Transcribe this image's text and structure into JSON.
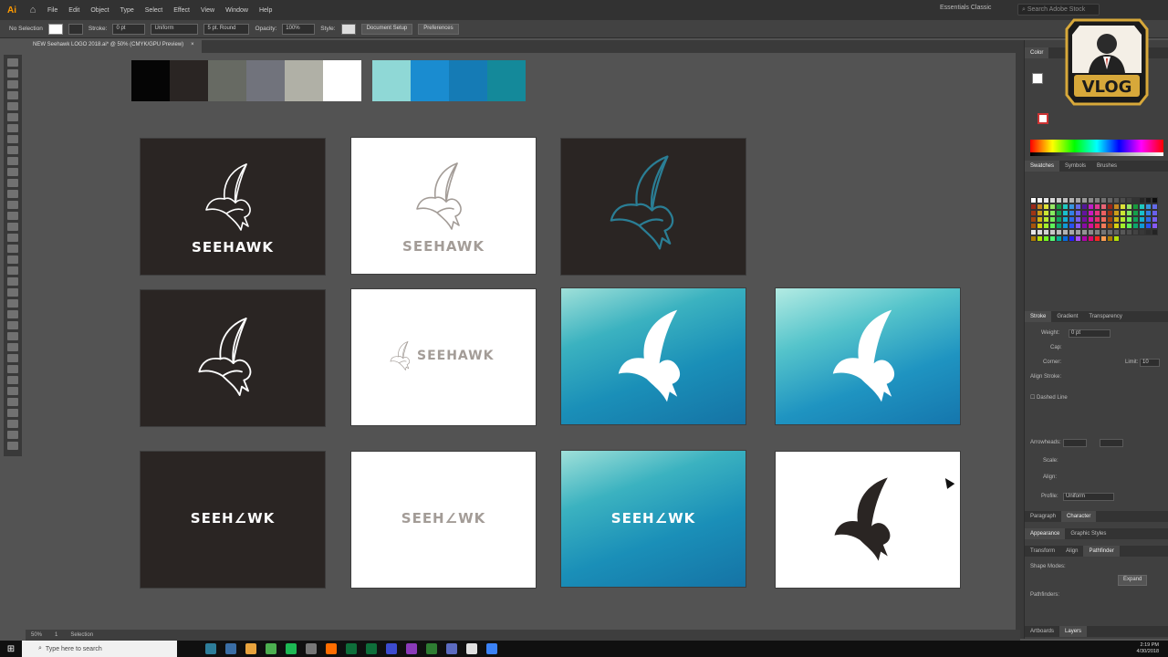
{
  "menubar": {
    "app_icon": "Ai",
    "items": [
      "File",
      "Edit",
      "Object",
      "Type",
      "Select",
      "Effect",
      "View",
      "Window",
      "Help"
    ],
    "workspace": "Essentials Classic",
    "search_placeholder": "Search Adobe Stock"
  },
  "controlbar": {
    "selection": "No Selection",
    "stroke_label": "Stroke:",
    "stroke_value": "0 pt",
    "profile": "Uniform",
    "brush": "5 pt. Round",
    "opacity_label": "Opacity:",
    "opacity_value": "100%",
    "style_label": "Style:",
    "doc_setup": "Document Setup",
    "preferences": "Preferences"
  },
  "document_tab": {
    "title": "NEW Seehawk LOGO 2018.ai* @ 50% (CMYK/GPU Preview)",
    "close": "×"
  },
  "palette": {
    "neutrals": [
      "#050505",
      "#2a2523",
      "#676a63",
      "#71737c",
      "#b0b0a6",
      "#ffffff"
    ],
    "blues": [
      "#8fd8d6",
      "#1a8cd0",
      "#157bb5",
      "#14899a"
    ]
  },
  "logo": {
    "wordmark": "SEEHAWK",
    "wordmark_alt": "SEEH∠WK",
    "stroke_grey": "#a39c97",
    "stroke_teal": "#2a7e95"
  },
  "right_panel": {
    "color_tab": "Color",
    "swatches_tabs": [
      "Swatches",
      "Symbols",
      "Brushes"
    ],
    "stroke_tabs": [
      "Stroke",
      "Gradient",
      "Transparency"
    ],
    "weight_label": "Weight:",
    "weight_value": "0 pt",
    "cap_label": "Cap:",
    "corner_label": "Corner:",
    "limit_label": "Limit:",
    "limit_value": "10",
    "align_label": "Align Stroke:",
    "dashed_label": "Dashed Line",
    "arrowheads_label": "Arrowheads:",
    "scale_label": "Scale:",
    "align2_label": "Align:",
    "profile_label": "Profile:",
    "profile_value": "Uniform",
    "para_tabs": [
      "Paragraph",
      "Character"
    ],
    "appear_tabs": [
      "Appearance",
      "Graphic Styles"
    ],
    "transform_tabs": [
      "Transform",
      "Align",
      "Pathfinder"
    ],
    "shape_modes": "Shape Modes:",
    "pathfinders": "Pathfinders:",
    "expand": "Expand",
    "bottom_tabs": [
      "Artboards",
      "Layers"
    ]
  },
  "status": {
    "zoom": "50%",
    "artboard": "1",
    "tool": "Selection"
  },
  "taskbar": {
    "search": "Type here to search",
    "time": "2:19 PM",
    "date": "4/30/2018"
  },
  "badge": {
    "text": "VLOG",
    "colors": {
      "gold": "#d7a83a",
      "dark": "#1b1b1b",
      "red": "#c0392b"
    }
  },
  "icons": [
    "home-icon",
    "search-icon",
    "windows-icon",
    "cursor-icon"
  ]
}
